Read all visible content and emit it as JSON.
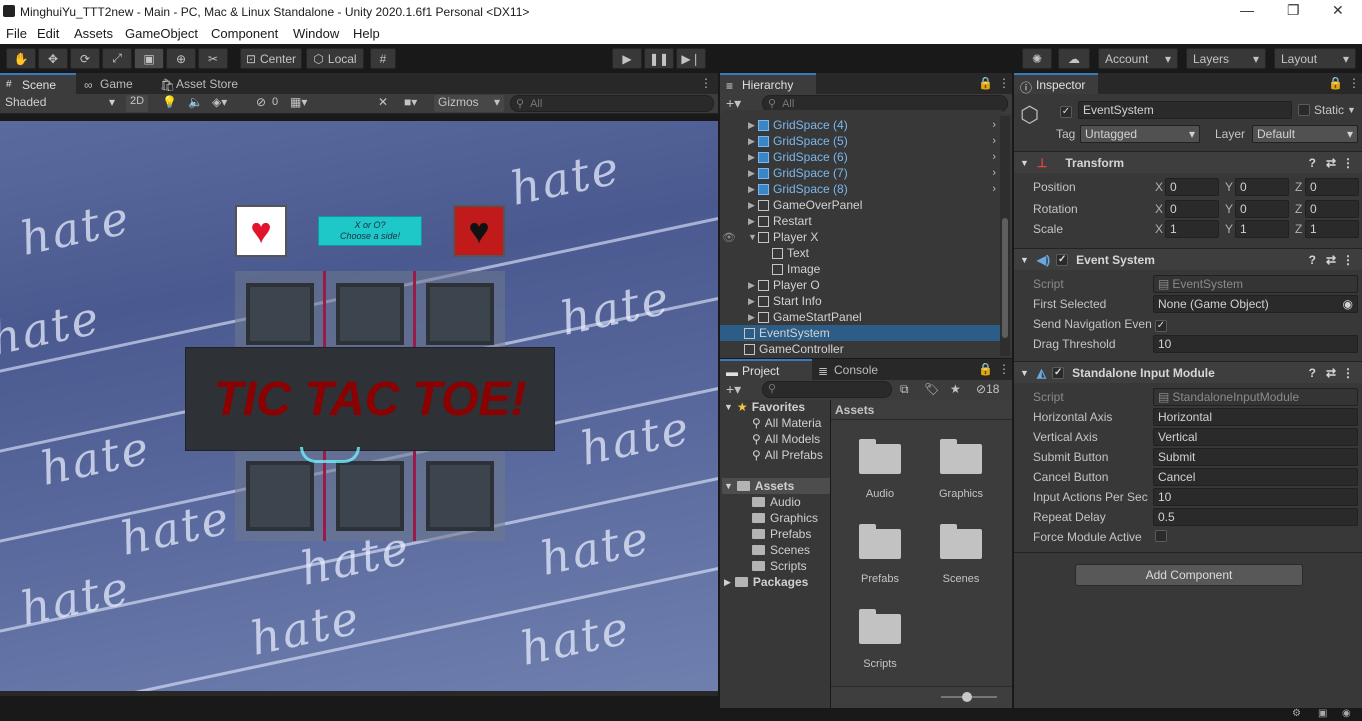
{
  "window": {
    "title": "MinghuiYu_TTT2new - Main - PC, Mac & Linux Standalone - Unity 2020.1.6f1 Personal <DX11>",
    "controls": [
      "—",
      "❐",
      "✕"
    ]
  },
  "menu": [
    "File",
    "Edit",
    "Assets",
    "GameObject",
    "Component",
    "Window",
    "Help"
  ],
  "toolbar": {
    "tools": [
      "hand-tool",
      "move-tool",
      "rotate-tool",
      "scale-tool",
      "rect-tool",
      "transform-tool",
      "custom-tool"
    ],
    "pivot": "Center",
    "space": "Local",
    "account": "Account",
    "layers": "Layers",
    "layout": "Layout"
  },
  "scene_panel": {
    "tabs": [
      "Scene",
      "Game",
      "Asset Store"
    ],
    "shading": "Shaded",
    "mode_2d": "2D",
    "hidden_count": "0",
    "gizmos": "Gizmos",
    "search_placeholder": "All"
  },
  "game_view": {
    "background_word": "hate",
    "title_banner": "TIC TAC TOE!",
    "side_prompt": "X or O?\nChoose a side!",
    "side_prompt_line1": "X or O?",
    "side_prompt_line2": "Choose a side!"
  },
  "hierarchy": {
    "tab": "Hierarchy",
    "search_placeholder": "All",
    "items": [
      {
        "label": "GridSpace (4)",
        "prefab": true,
        "indent": 2,
        "expand": "▶"
      },
      {
        "label": "GridSpace (5)",
        "prefab": true,
        "indent": 2,
        "expand": "▶"
      },
      {
        "label": "GridSpace (6)",
        "prefab": true,
        "indent": 2,
        "expand": "▶"
      },
      {
        "label": "GridSpace (7)",
        "prefab": true,
        "indent": 2,
        "expand": "▶"
      },
      {
        "label": "GridSpace (8)",
        "prefab": true,
        "indent": 2,
        "expand": "▶"
      },
      {
        "label": "GameOverPanel",
        "prefab": false,
        "indent": 2,
        "expand": "▶"
      },
      {
        "label": "Restart",
        "prefab": false,
        "indent": 2,
        "expand": "▶"
      },
      {
        "label": "Player X",
        "prefab": false,
        "indent": 2,
        "expand": "▼"
      },
      {
        "label": "Text",
        "prefab": false,
        "indent": 3,
        "expand": ""
      },
      {
        "label": "Image",
        "prefab": false,
        "indent": 3,
        "expand": ""
      },
      {
        "label": "Player O",
        "prefab": false,
        "indent": 2,
        "expand": "▶"
      },
      {
        "label": "Start Info",
        "prefab": false,
        "indent": 2,
        "expand": "▶"
      },
      {
        "label": "GameStartPanel",
        "prefab": false,
        "indent": 2,
        "expand": "▶"
      },
      {
        "label": "EventSystem",
        "prefab": false,
        "indent": 1,
        "expand": "",
        "selected": true
      },
      {
        "label": "GameController",
        "prefab": false,
        "indent": 1,
        "expand": ""
      }
    ]
  },
  "project": {
    "tabs": [
      "Project",
      "Console"
    ],
    "console_count": "18",
    "favorites_label": "Favorites",
    "favorites": [
      "All Materia",
      "All Models",
      "All Prefabs"
    ],
    "assets_label": "Assets",
    "asset_folders": [
      "Audio",
      "Graphics",
      "Prefabs",
      "Scenes",
      "Scripts"
    ],
    "packages_label": "Packages",
    "grid_header": "Assets",
    "grid_items": [
      "Audio",
      "Graphics",
      "Prefabs",
      "Scenes",
      "Scripts"
    ]
  },
  "inspector": {
    "tab": "Inspector",
    "object_name": "EventSystem",
    "static_label": "Static",
    "tag_label": "Tag",
    "tag_value": "Untagged",
    "layer_label": "Layer",
    "layer_value": "Default",
    "transform": {
      "title": "Transform",
      "rows": [
        {
          "label": "Position",
          "x": "0",
          "y": "0",
          "z": "0"
        },
        {
          "label": "Rotation",
          "x": "0",
          "y": "0",
          "z": "0"
        },
        {
          "label": "Scale",
          "x": "1",
          "y": "1",
          "z": "1"
        }
      ]
    },
    "event_system": {
      "title": "Event System",
      "script_label": "Script",
      "script_value": "EventSystem",
      "first_selected_label": "First Selected",
      "first_selected_value": "None (Game Object)",
      "send_nav_label": "Send Navigation Even",
      "drag_threshold_label": "Drag Threshold",
      "drag_threshold_value": "10"
    },
    "input_module": {
      "title": "Standalone Input Module",
      "script_label": "Script",
      "script_value": "StandaloneInputModule",
      "rows": [
        {
          "label": "Horizontal Axis",
          "value": "Horizontal"
        },
        {
          "label": "Vertical Axis",
          "value": "Vertical"
        },
        {
          "label": "Submit Button",
          "value": "Submit"
        },
        {
          "label": "Cancel Button",
          "value": "Cancel"
        },
        {
          "label": "Input Actions Per Sec",
          "value": "10"
        },
        {
          "label": "Repeat Delay",
          "value": "0.5"
        }
      ],
      "force_label": "Force Module Active"
    },
    "add_component": "Add Component"
  },
  "colors": {
    "accent": "#3a79bb",
    "selection": "#2c5d87",
    "title_red": "#8b0000",
    "prompt_cyan": "#1ec8c8"
  }
}
